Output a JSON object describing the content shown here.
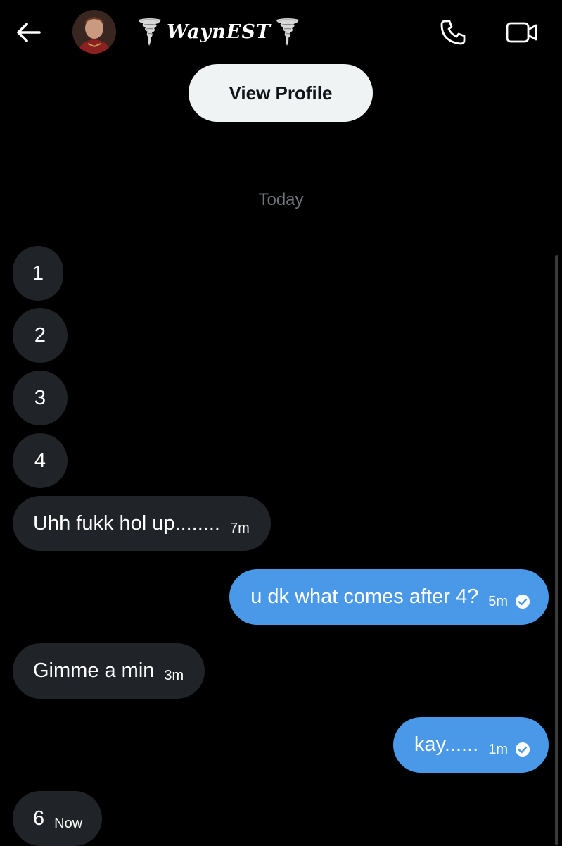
{
  "header": {
    "back_icon": "arrow-left-icon",
    "avatar_icon": "profile-avatar",
    "name": "WaynEST",
    "name_decoration_icon": "tornado-icon",
    "call_icon": "phone-icon",
    "video_icon": "video-camera-icon"
  },
  "profile": {
    "view_profile_label": "View Profile"
  },
  "date_separator": "Today",
  "messages": [
    {
      "direction": "incoming",
      "text": "1",
      "time": ""
    },
    {
      "direction": "incoming",
      "text": "2",
      "time": ""
    },
    {
      "direction": "incoming",
      "text": "3",
      "time": ""
    },
    {
      "direction": "incoming",
      "text": "4",
      "time": ""
    },
    {
      "direction": "incoming",
      "text": "Uhh fukk hol up........",
      "time": "7m"
    },
    {
      "direction": "outgoing",
      "text": "u dk what comes after 4?",
      "time": "5m",
      "status_icon": "check-circle-icon"
    },
    {
      "direction": "incoming",
      "text": "Gimme a min",
      "time": "3m"
    },
    {
      "direction": "outgoing",
      "text": "kay......",
      "time": "1m",
      "status_icon": "check-circle-icon"
    },
    {
      "direction": "incoming",
      "text": "6",
      "time": "Now"
    }
  ],
  "colors": {
    "background": "#000000",
    "incoming_bubble": "#202327",
    "outgoing_bubble": "#4a99e9",
    "view_profile_bg": "#eff3f4",
    "muted_text": "#71767b"
  }
}
